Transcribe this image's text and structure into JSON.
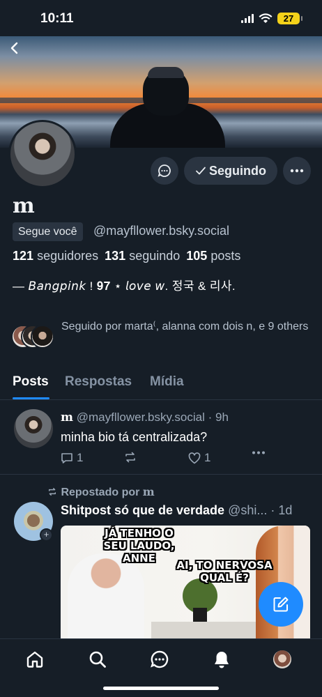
{
  "status_bar": {
    "time": "10:11",
    "battery": "27"
  },
  "profile": {
    "display_name": "m",
    "follows_you": "Segue você",
    "handle": "@mayfllower.bsky.social",
    "stats": {
      "followers_count": "121",
      "followers_label": "seguidores",
      "following_count": "131",
      "following_label": "seguindo",
      "posts_count": "105",
      "posts_label": "posts"
    },
    "bio": "—  𝘉𝘢𝘯𝘨𝘱𝘪𝘯𝘬  !  𝟗𝟕  ⋆  𝘭𝘰𝘷𝘦 𝘸.  정국  &  리사.",
    "following_button": "Seguindo",
    "followed_by": "Seguido por marta⁽, alanna com dois n, e 9 others"
  },
  "tabs": [
    "Posts",
    "Respostas",
    "Mídia"
  ],
  "posts": [
    {
      "author": "m",
      "handle": "@mayfllower.bsky.social",
      "time": "· 9h",
      "text": "minha bio tá centralizada?",
      "replies": "1",
      "likes": "1"
    },
    {
      "repost_prefix": "Repostado por",
      "repost_by": "m",
      "author": "Shitpost só que de verdade",
      "handle": "@shi...",
      "time": "· 1d",
      "meme_caption_1": "JÁ TENHO O SEU LAUDO, ANNE",
      "meme_caption_2": "AI, TO NERVOSA QUAL É?"
    }
  ],
  "icons": {
    "back": "chevron-left-icon",
    "message": "chat-bubble-icon",
    "check": "check-icon",
    "more": "ellipsis-icon",
    "compose": "pencil-square-icon",
    "nav": [
      "home-icon",
      "search-icon",
      "chat-icon",
      "bell-icon",
      "avatar"
    ]
  },
  "colors": {
    "accent": "#1f8bff",
    "background": "#161e27",
    "surface": "#2a3441"
  }
}
